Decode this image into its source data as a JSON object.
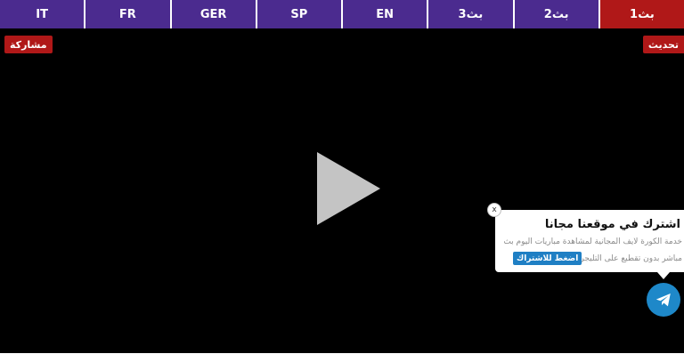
{
  "tabs": [
    {
      "label": "بث1",
      "active": true
    },
    {
      "label": "بث2",
      "active": false
    },
    {
      "label": "بث3",
      "active": false
    },
    {
      "label": "EN",
      "active": false
    },
    {
      "label": "SP",
      "active": false
    },
    {
      "label": "GER",
      "active": false
    },
    {
      "label": "FR",
      "active": false
    },
    {
      "label": "IT",
      "active": false
    }
  ],
  "player": {
    "share_label": "مشاركة",
    "refresh_label": "تحديث"
  },
  "popup": {
    "title": "اشترك في موقعنا مجانا",
    "line1": "خدمة الكورة لايف المجانية لمشاهدة مباريات اليوم بث",
    "line2": "مباشر بدون تقطيع على التليجرام",
    "subscribe_label": "اضغط للاشتراك",
    "close_label": "x"
  },
  "icons": {
    "play": "play-icon",
    "telegram": "telegram-icon",
    "close": "close-icon"
  },
  "colors": {
    "tab": "#4b2b8f",
    "tab_active": "#b01818",
    "telegram": "#1e88c9"
  }
}
